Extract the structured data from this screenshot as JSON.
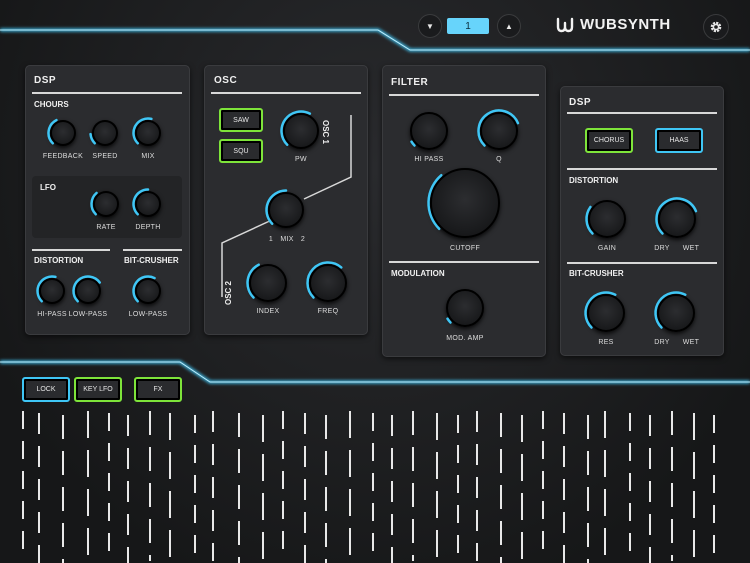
{
  "header": {
    "preset_number": "1",
    "brand": "WUBSYNTH",
    "icons": {
      "down": "chevron-down-icon",
      "up": "chevron-up-icon",
      "settings": "gear-icon",
      "logo": "wubsynth-logo-icon"
    }
  },
  "colors": {
    "accent_blue": "#3fc6f5",
    "accent_green": "#7ee43a",
    "panel": "#2b2c2f"
  },
  "dsp_left": {
    "title": "DSP",
    "chorus": {
      "title": "CHOURS",
      "knobs": [
        {
          "label": "FEEDBACK",
          "value": 0.4
        },
        {
          "label": "SPEED",
          "value": 0.15
        },
        {
          "label": "MIX",
          "value": 0.55
        }
      ]
    },
    "lfo": {
      "title": "LFO",
      "knobs": [
        {
          "label": "RATE",
          "value": 0.35
        },
        {
          "label": "DEPTH",
          "value": 0.5
        }
      ]
    },
    "distortion": {
      "title": "DISTORTION",
      "knobs": [
        {
          "label": "HI-PASS",
          "value": 0.55
        },
        {
          "label": "LOW-PASS",
          "value": 0.7
        }
      ]
    },
    "bitcrusher": {
      "title": "BIT-CRUSHER",
      "knobs": [
        {
          "label": "LOW-PASS",
          "value": 0.6
        }
      ]
    }
  },
  "osc": {
    "title": "OSC",
    "osc1_label": "OSC 1",
    "osc2_label": "OSC 2",
    "buttons": {
      "saw": "SAW",
      "squ": "SQU"
    },
    "knobs": {
      "pw": {
        "label": "PW",
        "value": 0.6
      },
      "index": {
        "label": "INDEX",
        "value": 0.4
      },
      "freq": {
        "label": "FREQ",
        "value": 0.65
      }
    },
    "mix": {
      "left": "1",
      "label": "MIX",
      "right": "2",
      "value": 0.5
    }
  },
  "filter": {
    "title": "FILTER",
    "knobs": {
      "hipass": {
        "label": "HI PASS",
        "value": 0.05
      },
      "q": {
        "label": "Q",
        "value": 0.75
      },
      "cutoff": {
        "label": "CUTOFF",
        "value": 0.35
      }
    },
    "modulation": {
      "title": "MODULATION",
      "knob": {
        "label": "MOD. AMP",
        "value": 0.05
      }
    }
  },
  "dsp_right": {
    "title": "DSP",
    "buttons": {
      "chorus": "CHORUS",
      "haas": "HAAS"
    },
    "distortion": {
      "title": "DISTORTION",
      "gain": {
        "label": "GAIN",
        "value": 0.3
      },
      "drywet": {
        "dry": "DRY",
        "wet": "WET",
        "value": 0.75
      }
    },
    "bitcrusher": {
      "title": "BIT-CRUSHER",
      "res": {
        "label": "RES",
        "value": 0.6
      },
      "drywet": {
        "dry": "DRY",
        "wet": "WET",
        "value": 0.6
      }
    }
  },
  "bottom": {
    "buttons": {
      "lock": "LOCK",
      "keylfo": "KEY LFO",
      "fx": "FX"
    }
  }
}
